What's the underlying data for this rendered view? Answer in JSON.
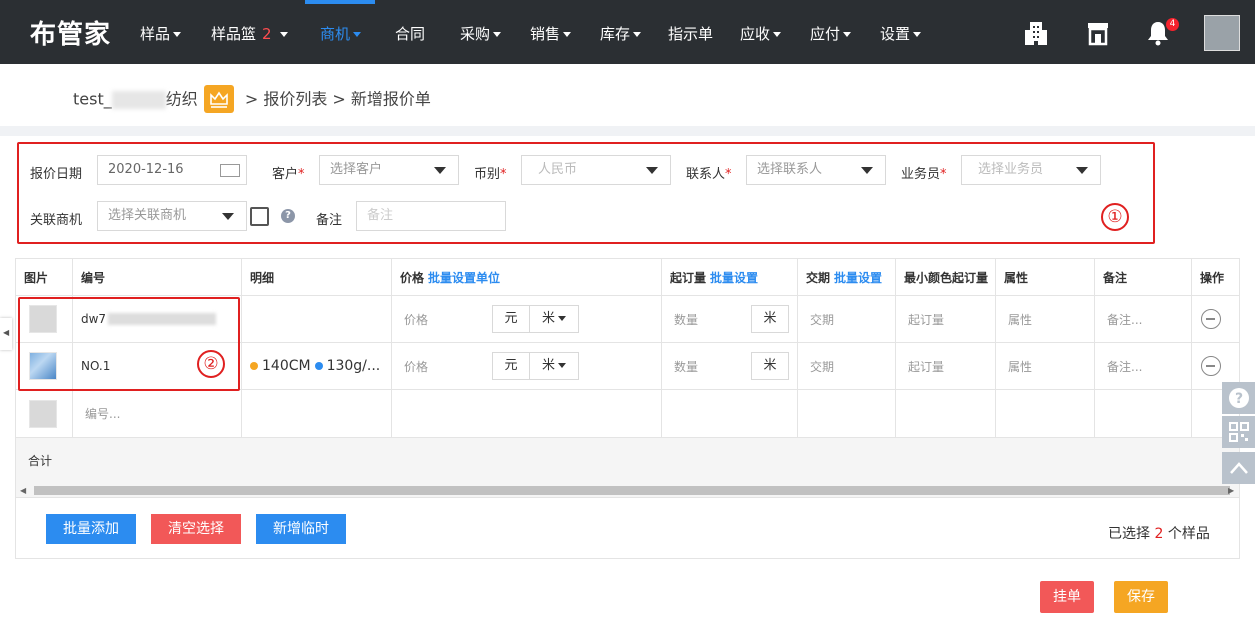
{
  "nav": {
    "logo": "布管家",
    "items": [
      {
        "label": "样品",
        "caret": true
      },
      {
        "label": "样品篮",
        "caret": true,
        "count": "2"
      },
      {
        "label": "商机",
        "caret": true,
        "active": true
      },
      {
        "label": "合同",
        "caret": false
      },
      {
        "label": "采购",
        "caret": true
      },
      {
        "label": "销售",
        "caret": true
      },
      {
        "label": "库存",
        "caret": true
      },
      {
        "label": "指示单",
        "caret": false
      },
      {
        "label": "应收",
        "caret": true
      },
      {
        "label": "应付",
        "caret": true
      },
      {
        "label": "设置",
        "caret": true
      }
    ],
    "bell_badge": "4",
    "icons": [
      "building-icon",
      "store-icon",
      "bell-icon",
      "avatar"
    ]
  },
  "breadcrumb": {
    "company_prefix": "test_",
    "company_suffix": "纺织",
    "sep1": " > ",
    "list": "报价列表",
    "sep2": " > ",
    "current": "新增报价单"
  },
  "form": {
    "date_label": "报价日期",
    "date_value": "2020-12-16",
    "customer_label": "客户",
    "customer_placeholder": "选择客户",
    "currency_label": "币别",
    "currency_value": "人民币",
    "contact_label": "联系人",
    "contact_placeholder": "选择联系人",
    "salesman_label": "业务员",
    "salesman_placeholder": "选择业务员",
    "opportunity_label": "关联商机",
    "opportunity_placeholder": "选择关联商机",
    "remark_label": "备注",
    "remark_placeholder": "备注",
    "annotation": "①"
  },
  "table": {
    "headers": {
      "image": "图片",
      "code": "编号",
      "detail": "明细",
      "price": "价格",
      "price_link": "批量设置单位",
      "moq": "起订量",
      "moq_link": "批量设置",
      "delivery": "交期",
      "delivery_link": "批量设置",
      "min_color_moq": "最小颜色起订量",
      "attr": "属性",
      "remark": "备注",
      "action": "操作"
    },
    "rows": [
      {
        "code": "dw7",
        "detail": "",
        "price_ph": "价格",
        "currency": "元",
        "unit": "米",
        "qty_ph": "数量",
        "qty_unit": "米",
        "delivery_ph": "交期",
        "moq_ph": "起订量",
        "attr_ph": "属性",
        "remark_ph": "备注..."
      },
      {
        "code": "NO.1",
        "detail_a": "140CM",
        "detail_b": "130g/...",
        "price_ph": "价格",
        "currency": "元",
        "unit": "米",
        "qty_ph": "数量",
        "qty_unit": "米",
        "delivery_ph": "交期",
        "moq_ph": "起订量",
        "attr_ph": "属性",
        "remark_ph": "备注..."
      }
    ],
    "new_row_placeholder": "编号...",
    "sum_label": "合计",
    "annotation": "②"
  },
  "actions": {
    "batch_add": "批量添加",
    "clear": "清空选择",
    "add_temp": "新增临时",
    "selected_prefix": "已选择 ",
    "selected_count": "2",
    "selected_suffix": " 个样品",
    "hold": "挂单",
    "save": "保存"
  },
  "colors": {
    "nav_bg": "#2b2f33",
    "accent": "#2c8cf0",
    "danger": "#f25858",
    "warning": "#f5a623",
    "annotation_red": "#e02020"
  }
}
